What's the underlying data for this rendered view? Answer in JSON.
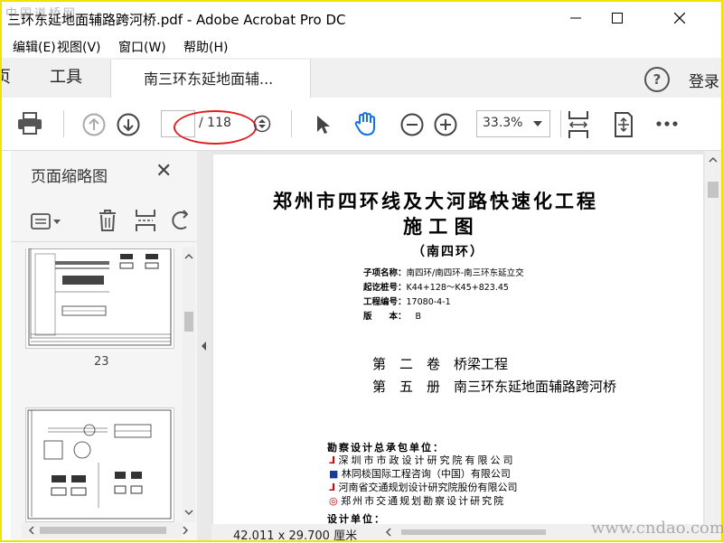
{
  "window": {
    "title": "三环东延地面辅路跨河桥.pdf - Adobe Acrobat Pro DC",
    "controls": [
      "minimize-icon",
      "maximize-icon",
      "close-icon"
    ]
  },
  "menu": [
    "编辑(E)",
    "视图(V)",
    "窗口(W)",
    "帮助(H)"
  ],
  "tabs": {
    "home_partial": "页",
    "tools": "工具",
    "document": "南三环东延地面辅..."
  },
  "account": {
    "login": "登录"
  },
  "toolbar": {
    "page_current": "",
    "page_total": "/ 118",
    "zoom": "33.3%",
    "icons": [
      "print-icon",
      "page-up-icon",
      "page-down-icon",
      "page-stepper-icon",
      "select-pointer-icon",
      "hand-tool-icon",
      "zoom-out-icon",
      "zoom-in-icon",
      "zoom-dropdown-icon",
      "fit-width-icon",
      "fit-page-icon",
      "more-icon"
    ]
  },
  "sidepanel": {
    "title": "页面缩略图",
    "thumbnail_page_label": "23",
    "icons": [
      "thumbnail-options-icon",
      "delete-icon",
      "insert-page-icon",
      "rotate-icon"
    ]
  },
  "document_page": {
    "heading_1": "郑州市四环线及大河路快速化工程",
    "heading_2": "施 工 图",
    "heading_3": "（南四环）",
    "meta": [
      {
        "label": "子项名称：",
        "value": "南四环/南四环-南三环东延立交"
      },
      {
        "label": "起讫桩号：",
        "value": "K44+128～K45+823.45"
      },
      {
        "label": "工程编号：",
        "value": "17080-4-1"
      },
      {
        "label": "版　　本：",
        "value": "B"
      }
    ],
    "volume_line": "第　二　卷　桥梁工程",
    "book_line": "第　五　册　南三环东延地面辅路跨河桥",
    "general_contractor_label": "勘察设计总承包单位：",
    "contractors": [
      "深圳市市政设计研究院有限公司",
      "林同棪国际工程咨询（中国）有限公司",
      "河南省交通规划设计研究院股份有限公司",
      "郑州市交通规划勘察设计研究院"
    ],
    "design_unit_label": "设计单位："
  },
  "status": {
    "page_size": "42.011 x 29.700 厘米"
  },
  "watermarks": {
    "top_left": "中国道桥网",
    "bottom_right": "www.cndao.com"
  },
  "colors": {
    "annotation_oval": "#e02020",
    "border": "#f2e200",
    "acrobat_blue": "#1473e6"
  }
}
